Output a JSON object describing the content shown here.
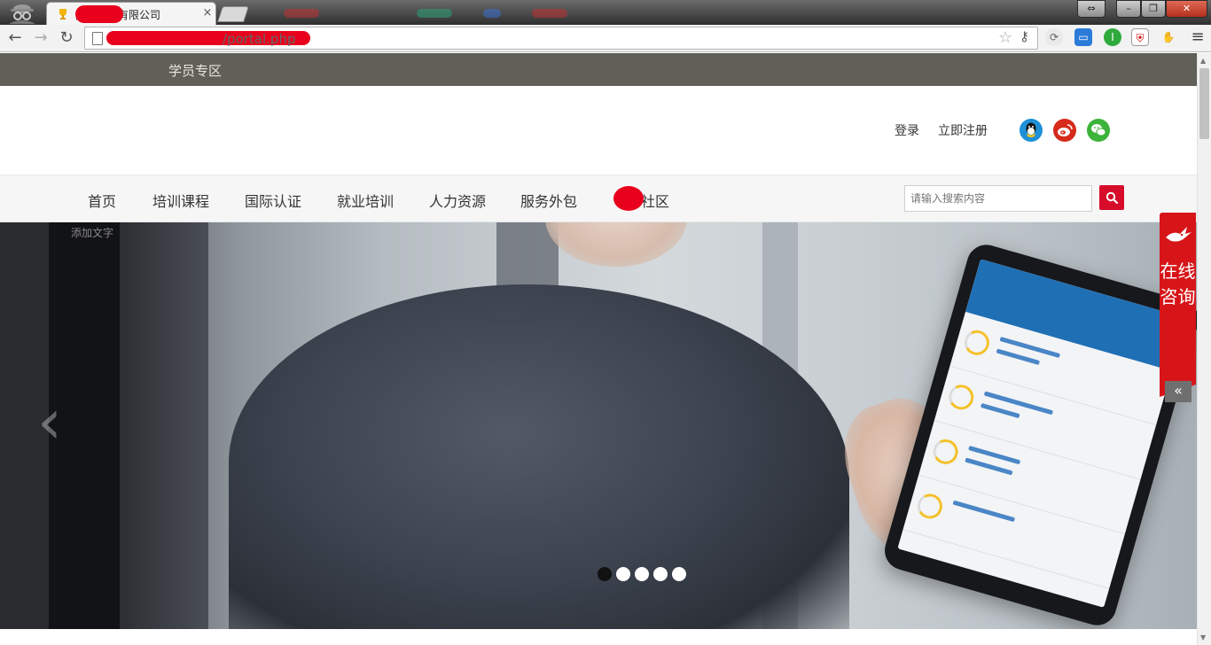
{
  "browser": {
    "tab": {
      "title": "网络技术有限公司",
      "close_label": "×"
    },
    "address": {
      "url_suffix": "/portal.php"
    },
    "controls": {
      "back": "←",
      "forward": "→",
      "reload": "↻",
      "star": "☆",
      "menu": "≡"
    },
    "window": {
      "extra": "⇔",
      "minimize": "–",
      "maximize": "❐",
      "close": "✕"
    }
  },
  "topbar": {
    "student_area": "学员专区"
  },
  "header": {
    "login": "登录",
    "register": "立即注册"
  },
  "nav": {
    "items": [
      {
        "label": "首页"
      },
      {
        "label": "培训课程"
      },
      {
        "label": "国际认证"
      },
      {
        "label": "就业培训"
      },
      {
        "label": "人力资源"
      },
      {
        "label": "服务外包"
      },
      {
        "label": "社区"
      }
    ]
  },
  "search": {
    "placeholder": "请输入搜索内容"
  },
  "banner": {
    "caption": "添加文字",
    "prev_label": "‹",
    "slide_count": 5,
    "active_slide": 1
  },
  "consult": {
    "label": "在线咨询",
    "collapse_label": "«"
  },
  "colors": {
    "topbar": "#616058",
    "brand_red": "#d71518",
    "search_button": "#d70c2b",
    "qq": "#1e90d6",
    "weibo": "#d62a1b",
    "wechat": "#3cb33a"
  },
  "icons": {
    "social": [
      "qq-icon",
      "weibo-icon",
      "wechat-icon"
    ],
    "search": "search-icon"
  }
}
